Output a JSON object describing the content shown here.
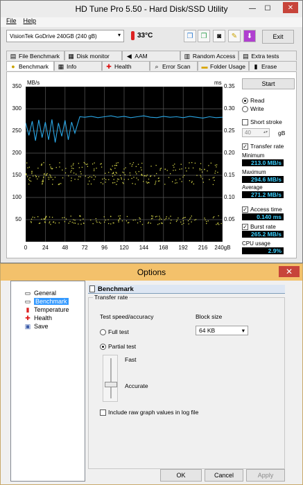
{
  "main_window": {
    "title": "HD Tune Pro 5.50 - Hard Disk/SSD Utility",
    "window_controls": {
      "minimize": "—",
      "maximize": "☐",
      "close": "✕"
    },
    "menu": [
      "File",
      "Help"
    ],
    "drive": "VisionTek GoDrive 240GB (240 gB)",
    "temperature": "33°C",
    "exit_label": "Exit",
    "tabs_top": [
      "File Benchmark",
      "Disk monitor",
      "AAM",
      "Random Access",
      "Extra tests"
    ],
    "tabs_bottom": [
      "Benchmark",
      "Info",
      "Health",
      "Error Scan",
      "Folder Usage",
      "Erase"
    ],
    "active_tab": "Benchmark"
  },
  "benchmark": {
    "left_unit": "MB/s",
    "right_unit": "ms",
    "left_ticks": [
      "350",
      "300",
      "250",
      "200",
      "150",
      "100",
      "50"
    ],
    "right_ticks": [
      "0.35",
      "0.30",
      "0.25",
      "0.20",
      "0.15",
      "0.10",
      "0.05"
    ],
    "x_ticks": [
      "0",
      "24",
      "48",
      "72",
      "96",
      "120",
      "144",
      "168",
      "192",
      "216",
      "240gB"
    ],
    "start_label": "Start",
    "read_label": "Read",
    "write_label": "Write",
    "short_stroke_label": "Short stroke",
    "short_stroke_value": "40",
    "short_stroke_unit": "gB",
    "transfer_rate_label": "Transfer rate",
    "minimum_label": "Minimum",
    "minimum_value": "213.0 MB/s",
    "maximum_label": "Maximum",
    "maximum_value": "294.6 MB/s",
    "average_label": "Average",
    "average_value": "271.2 MB/s",
    "access_time_label": "Access time",
    "access_time_value": "0.140 ms",
    "burst_rate_label": "Burst rate",
    "burst_rate_value": "265.2 MB/s",
    "cpu_usage_label": "CPU usage",
    "cpu_usage_value": "2.9%"
  },
  "chart_data": {
    "type": "line",
    "x_range": [
      0,
      240
    ],
    "y_range": [
      0,
      350
    ],
    "y2_range": [
      0,
      0.35
    ],
    "series": [
      {
        "color": "#2aa7e6",
        "axis": "left",
        "x": [
          0,
          4,
          8,
          12,
          16,
          20,
          24,
          28,
          32,
          36,
          40,
          44,
          48,
          52,
          56,
          60,
          66,
          72,
          80,
          88,
          96,
          104,
          112,
          120,
          128,
          136,
          144,
          152,
          160,
          168,
          176,
          184,
          192,
          200,
          208,
          216,
          224,
          232,
          240
        ],
        "values": [
          268,
          240,
          272,
          228,
          275,
          235,
          270,
          230,
          276,
          224,
          268,
          238,
          274,
          230,
          270,
          245,
          282,
          281,
          283,
          280,
          282,
          284,
          281,
          283,
          280,
          282,
          284,
          281,
          280,
          283,
          281,
          282,
          280,
          283,
          281,
          279,
          282,
          280,
          281
        ]
      }
    ],
    "scatter_series": [
      {
        "color": "#d9d94a",
        "axis": "right",
        "band": [
          0.13,
          0.18
        ]
      },
      {
        "color": "#d9d94a",
        "axis": "right",
        "band": [
          0.04,
          0.06
        ]
      }
    ],
    "grid": true,
    "background": "#000000"
  },
  "options": {
    "title": "Options",
    "close": "✕",
    "tree": [
      {
        "label": "General",
        "icon": "page-icon"
      },
      {
        "label": "Benchmark",
        "icon": "page-icon",
        "selected": true
      },
      {
        "label": "Temperature",
        "icon": "thermometer-icon"
      },
      {
        "label": "Health",
        "icon": "health-cross-icon"
      },
      {
        "label": "Save",
        "icon": "save-icon"
      }
    ],
    "section_title": "Benchmark",
    "group_title": "Transfer rate",
    "speed_label": "Test speed/accuracy",
    "full_test": "Full test",
    "partial_test": "Partial test",
    "fast": "Fast",
    "accurate": "Accurate",
    "block_size_label": "Block size",
    "block_size_value": "64 KB",
    "raw_values_label": "Include raw graph values in log file",
    "ok": "OK",
    "cancel": "Cancel",
    "apply": "Apply"
  }
}
